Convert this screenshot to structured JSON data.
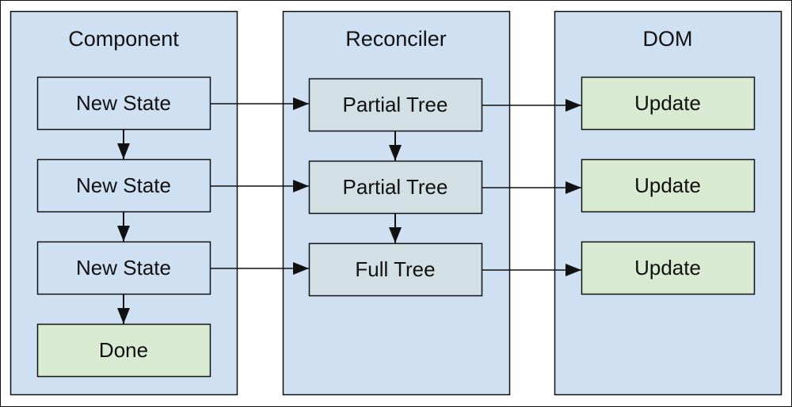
{
  "colors": {
    "panel": "#cfe0f3",
    "box_blue": "#cfe0f3",
    "box_teal": "#d2dfe5",
    "box_green": "#d9ead3",
    "stroke": "#111111"
  },
  "columns": [
    {
      "title": "Component",
      "boxes": [
        {
          "label": "New State",
          "color": "box_blue"
        },
        {
          "label": "New State",
          "color": "box_blue"
        },
        {
          "label": "New State",
          "color": "box_blue"
        },
        {
          "label": "Done",
          "color": "box_green"
        }
      ]
    },
    {
      "title": "Reconciler",
      "boxes": [
        {
          "label": "Partial Tree",
          "color": "box_teal"
        },
        {
          "label": "Partial Tree",
          "color": "box_teal"
        },
        {
          "label": "Full Tree",
          "color": "box_teal"
        }
      ]
    },
    {
      "title": "DOM",
      "boxes": [
        {
          "label": "Update",
          "color": "box_green"
        },
        {
          "label": "Update",
          "color": "box_green"
        },
        {
          "label": "Update",
          "color": "box_green"
        }
      ]
    }
  ],
  "edges": [
    {
      "from": "0.0",
      "to": "0.1"
    },
    {
      "from": "0.1",
      "to": "0.2"
    },
    {
      "from": "0.2",
      "to": "0.3"
    },
    {
      "from": "1.0",
      "to": "1.1"
    },
    {
      "from": "1.1",
      "to": "1.2"
    },
    {
      "from": "0.0",
      "to": "1.0"
    },
    {
      "from": "0.1",
      "to": "1.1"
    },
    {
      "from": "0.2",
      "to": "1.2"
    },
    {
      "from": "1.0",
      "to": "2.0"
    },
    {
      "from": "1.1",
      "to": "2.1"
    },
    {
      "from": "1.2",
      "to": "2.2"
    }
  ]
}
